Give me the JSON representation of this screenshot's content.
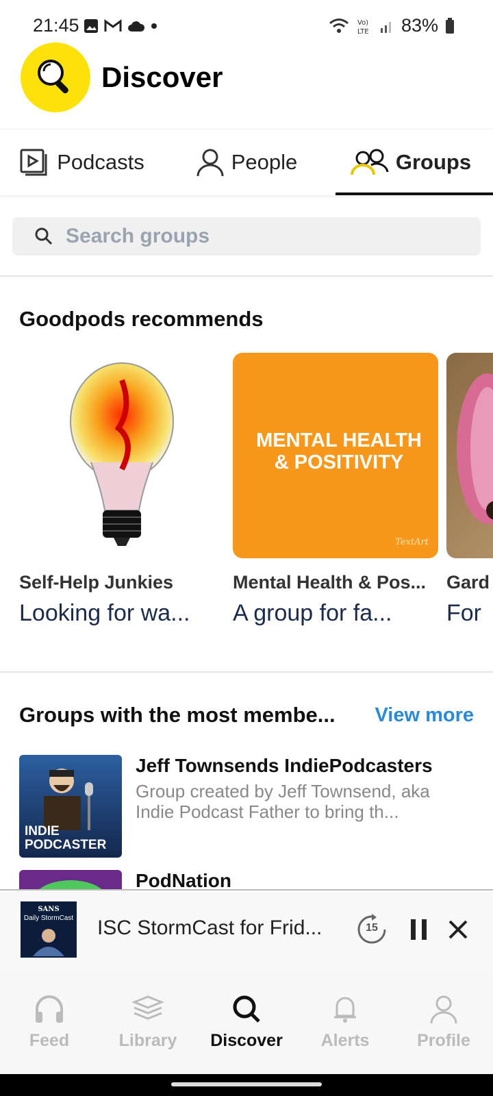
{
  "status_bar": {
    "time": "21:45",
    "battery": "83%"
  },
  "header": {
    "title": "Discover"
  },
  "tabs": [
    {
      "label": "Podcasts",
      "icon": "podcast-icon",
      "active": false
    },
    {
      "label": "People",
      "icon": "person-icon",
      "active": false
    },
    {
      "label": "Groups",
      "icon": "groups-icon",
      "active": true
    }
  ],
  "search": {
    "placeholder": "Search groups"
  },
  "recommends": {
    "title": "Goodpods recommends",
    "cards": [
      {
        "name": "Self-Help Junkies",
        "desc": "Looking for wa..."
      },
      {
        "name": "Mental Health & Pos...",
        "desc": "A group for fa...",
        "art_text": "MENTAL HEALTH & POSITIVITY",
        "art_sub": "TextArt"
      },
      {
        "name": "Gard",
        "desc": "For"
      }
    ]
  },
  "most_members": {
    "title": "Groups with the most membe...",
    "view_more": "View more",
    "groups": [
      {
        "name": "Jeff Townsends IndiePodcasters",
        "desc": "Group created by Jeff Townsend, aka Indie Podcast Father to bring th...",
        "art_text": "INDIE PODCASTER"
      },
      {
        "name": "PodNation",
        "desc": ""
      }
    ]
  },
  "player": {
    "title": "ISC StormCast for Frid...",
    "art_text": "Daily StormCast",
    "art_brand": "SANS",
    "skip": "15"
  },
  "nav": [
    {
      "label": "Feed",
      "icon": "headphones-icon",
      "active": false
    },
    {
      "label": "Library",
      "icon": "library-icon",
      "active": false
    },
    {
      "label": "Discover",
      "icon": "search-icon",
      "active": true
    },
    {
      "label": "Alerts",
      "icon": "bell-icon",
      "active": false
    },
    {
      "label": "Profile",
      "icon": "profile-icon",
      "active": false
    }
  ]
}
